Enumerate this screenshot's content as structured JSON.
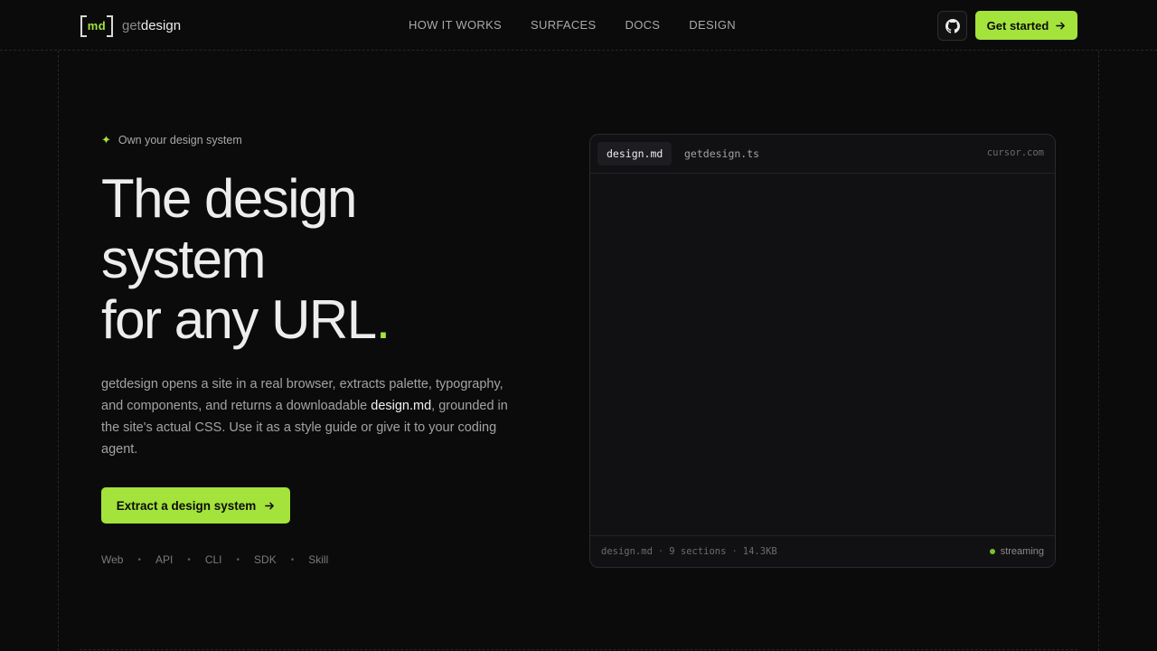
{
  "header": {
    "logo_mark": "md",
    "logo_get": "get",
    "logo_design": "design",
    "nav": [
      "HOW IT WORKS",
      "SURFACES",
      "DOCS",
      "DESIGN"
    ],
    "cta_label": "Get started"
  },
  "hero": {
    "eyebrow": "Own your design system",
    "headline": [
      "The design",
      "system",
      "for any URL"
    ],
    "headline_dot": ".",
    "lede_before": "getdesign opens a site in a real browser, extracts palette, typography, and components, and returns a downloadable ",
    "lede_highlight": "design.md",
    "lede_after": ", grounded in the site's actual CSS. Use it as a style guide or give it to your coding agent.",
    "cta_label": "Extract a design system",
    "surfaces": [
      "Web",
      "API",
      "CLI",
      "SDK",
      "Skill"
    ]
  },
  "panel": {
    "tabs": [
      "design.md",
      "getdesign.ts"
    ],
    "host": "cursor.com",
    "footer": {
      "file": "design.md",
      "sections": "9 sections",
      "size": "14.3KB",
      "status": "streaming"
    }
  },
  "colors": {
    "accent": "#a4e33b",
    "background": "#0b0b0c",
    "panel": "#111114"
  },
  "icons": {
    "github": "github-icon",
    "arrow": "arrow-right-icon",
    "spark": "sparkle-icon"
  }
}
